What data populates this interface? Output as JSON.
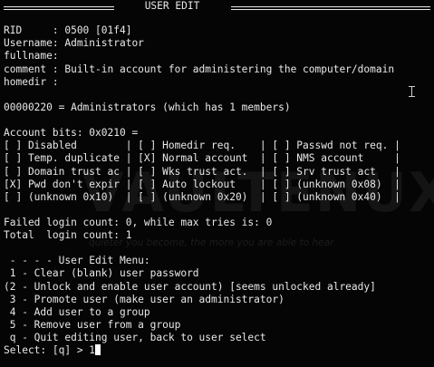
{
  "title": "USER EDIT",
  "user": {
    "rid": "RID     : 0500 [01f4]",
    "username": "Username: Administrator",
    "fullname": "fullname:",
    "comment": "comment : Built-in account for administering the computer/domain",
    "homedir": "homedir :"
  },
  "group_line": "00000220 = Administrators (which has 1 members)",
  "account_bits": {
    "header": "Account bits: 0x0210 =",
    "rows": [
      "[ ] Disabled        | [ ] Homedir req.    | [ ] Passwd not req. |",
      "[ ] Temp. duplicate | [X] Normal account  | [ ] NMS account     |",
      "[ ] Domain trust ac | [ ] Wks trust act.  | [ ] Srv trust act   |",
      "[X] Pwd don't expir | [ ] Auto lockout    | [ ] (unknown 0x08)  |",
      "[ ] (unknown 0x10)  | [ ] (unknown 0x20)  | [ ] (unknown 0x40)  |"
    ]
  },
  "login": {
    "failed": "Failed login count: 0, while max tries is: 0",
    "total": "Total  login count: 1"
  },
  "menu": {
    "header": " - - - - User Edit Menu:",
    "items": [
      " 1 - Clear (blank) user password",
      "(2 - Unlock and enable user account) [seems unlocked already]",
      " 3 - Promote user (make user an administrator)",
      " 4 - Add user to a group",
      " 5 - Remove user from a group",
      " q - Quit editing user, back to user select"
    ]
  },
  "prompt": {
    "label": "Select: [q] > ",
    "value": "1"
  },
  "watermark": {
    "text": "VAULTENUX",
    "quote": "quieter you become, the more you are able to hear"
  },
  "colors": {
    "background": "#050505",
    "text": "#e8e8e8",
    "cursor": "#ffffff"
  },
  "icons": {
    "cursor": "block-cursor-icon",
    "pointer": "ibeam-cursor-icon"
  }
}
